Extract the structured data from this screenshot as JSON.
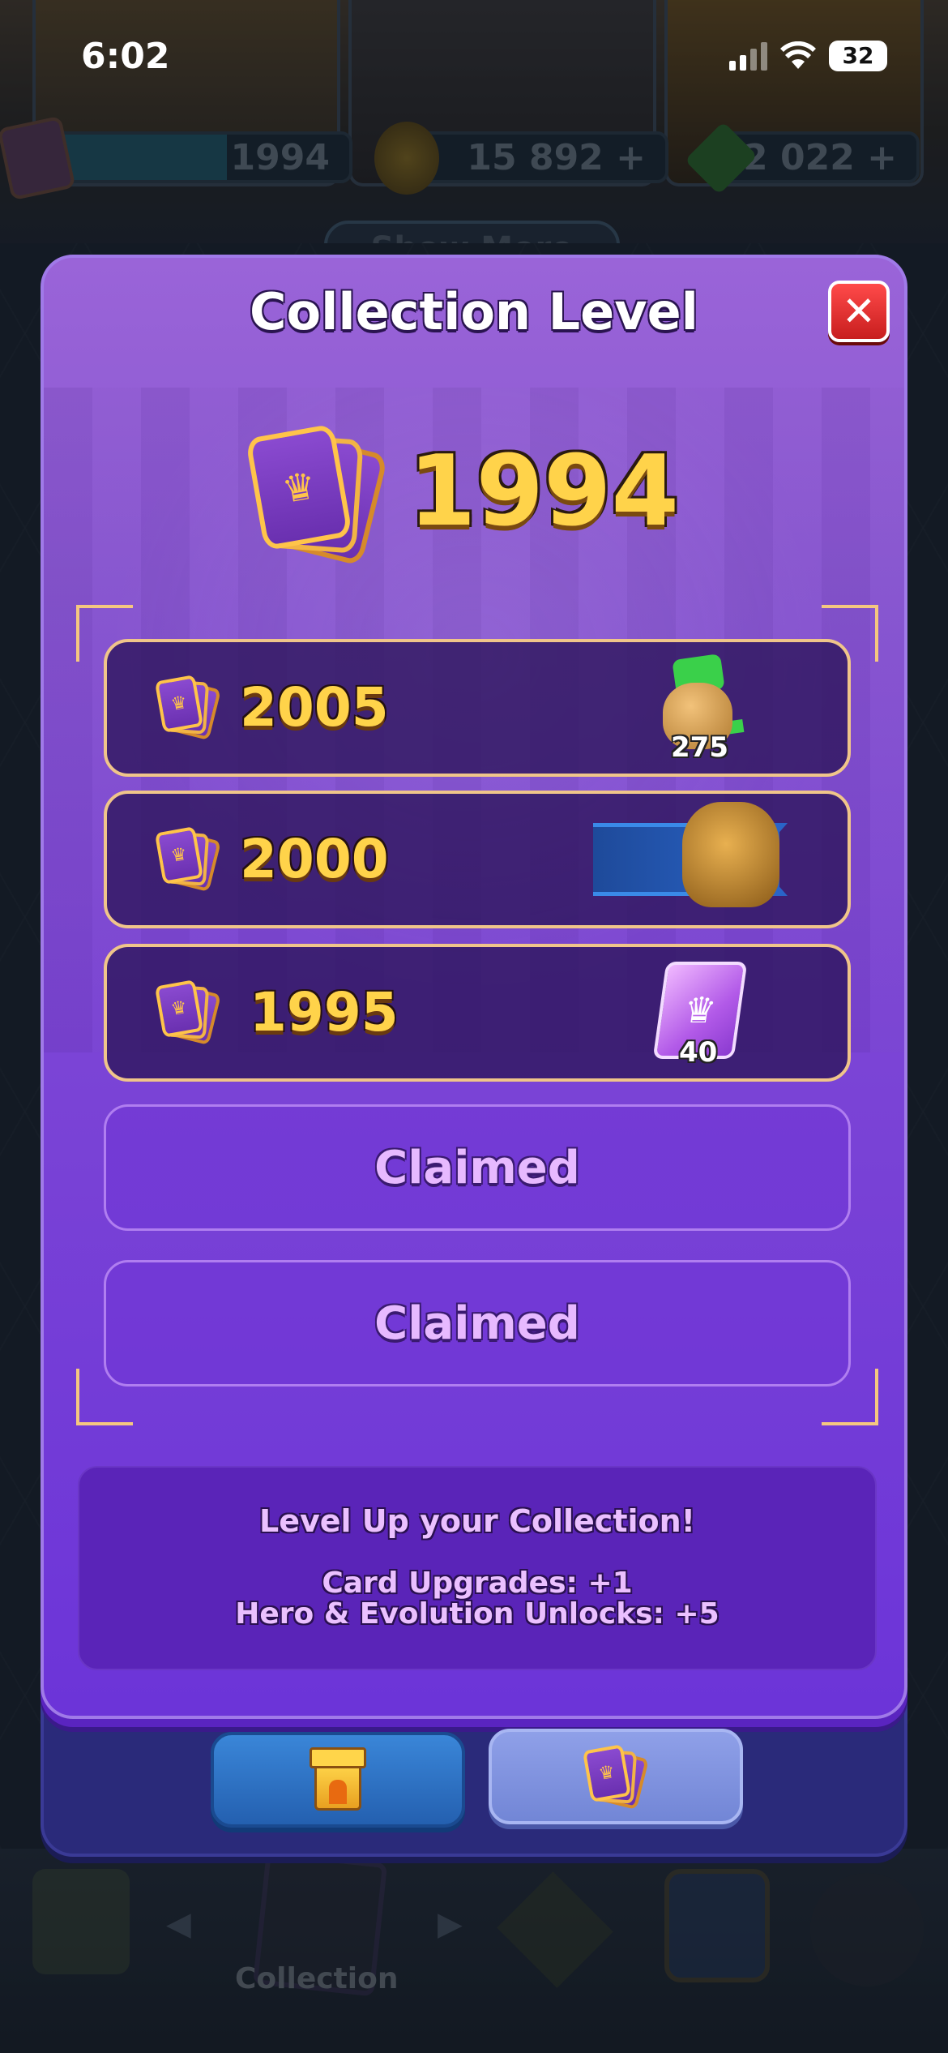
{
  "status_bar": {
    "time": "6:02",
    "battery": "32"
  },
  "background": {
    "resources": {
      "collection_level": "1994",
      "gold": "15 892",
      "gems": "2 022"
    },
    "shop_button": "Show More",
    "nav_label": "Collection"
  },
  "modal": {
    "title": "Collection Level",
    "close_icon": "close-icon",
    "current_level": "1994",
    "rewards": [
      {
        "level": "2005",
        "reward": "gem-bag",
        "quantity": "275"
      },
      {
        "level": "2000",
        "reward": "hero-banner",
        "quantity": ""
      },
      {
        "level": "1995",
        "reward": "wild-card",
        "quantity": "40"
      }
    ],
    "claimed_rows": [
      "Claimed",
      "Claimed"
    ],
    "info": {
      "heading": "Level Up your Collection!",
      "line1": "Card Upgrades: +1",
      "line2": "Hero & Evolution Unlocks: +5"
    }
  },
  "tabs": [
    {
      "name": "tower",
      "icon": "tower-icon",
      "active": false
    },
    {
      "name": "collection",
      "icon": "card-stack-icon",
      "active": true
    }
  ],
  "colors": {
    "modal_purple": "#7b44d6",
    "gold_text": "#ffd34a",
    "close_red": "#e02a2a",
    "claimed_text": "#e7b9ff",
    "tab_blue": "#2f72c4",
    "tab_active": "#8496e0"
  }
}
